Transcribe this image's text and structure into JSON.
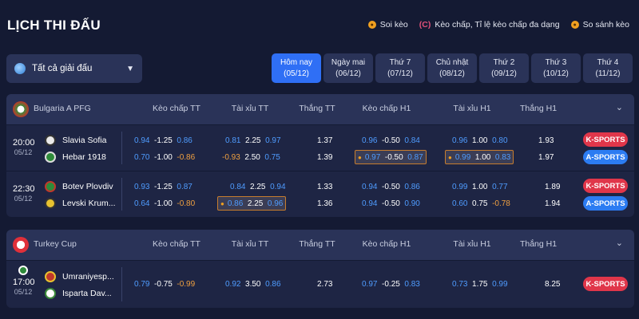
{
  "page": {
    "title": "LỊCH THI ĐẤU"
  },
  "legend": [
    {
      "icon": "coin-icon",
      "label": "Soi kèo"
    },
    {
      "icon": "c-icon",
      "label": "Kèo chấp, Tỉ lệ kèo chấp đa dạng"
    },
    {
      "icon": "coin-icon",
      "label": "So sánh kèo"
    }
  ],
  "league_select": {
    "label": "Tất cả giải đấu"
  },
  "days": [
    {
      "name": "Hôm nay",
      "date": "(05/12)",
      "active": true
    },
    {
      "name": "Ngày mai",
      "date": "(06/12)"
    },
    {
      "name": "Thứ 7",
      "date": "(07/12)"
    },
    {
      "name": "Chủ nhật",
      "date": "(08/12)"
    },
    {
      "name": "Thứ 2",
      "date": "(09/12)"
    },
    {
      "name": "Thứ 3",
      "date": "(10/12)"
    },
    {
      "name": "Thứ 4",
      "date": "(11/12)"
    }
  ],
  "columns": [
    "Kèo chấp TT",
    "Tài xỉu TT",
    "Thắng TT",
    "Kèo chấp H1",
    "Tài xỉu H1",
    "Thắng H1"
  ],
  "leagues": [
    {
      "name": "Bulgaria A PFG",
      "matches": [
        {
          "time": "20:00",
          "date": "05/12",
          "home": "Slavia Sofia",
          "away": "Hebar 1918",
          "home_row": {
            "hc_tt": [
              "0.94",
              "-1.25",
              "0.86"
            ],
            "ou_tt": [
              "0.81",
              "2.25",
              "0.97"
            ],
            "win_tt": "1.37",
            "hc_h1": [
              "0.96",
              "-0.50",
              "0.84"
            ],
            "ou_h1": [
              "0.96",
              "1.00",
              "0.80"
            ],
            "win_h1": "1.93"
          },
          "away_row": {
            "hc_tt": [
              "0.70",
              "-1.00",
              "-0.86"
            ],
            "ou_tt": [
              "-0.93",
              "2.50",
              "0.75"
            ],
            "win_tt": "1.39",
            "hc_h1": [
              "0.97",
              "-0.50",
              "0.87"
            ],
            "ou_h1": [
              "0.99",
              "1.00",
              "0.83"
            ],
            "win_h1": "1.97"
          },
          "buttons": [
            "K-SPORTS",
            "A-SPORTS"
          ]
        },
        {
          "time": "22:30",
          "date": "05/12",
          "home": "Botev Plovdiv",
          "away": "Levski Krum...",
          "home_row": {
            "hc_tt": [
              "0.93",
              "-1.25",
              "0.87"
            ],
            "ou_tt": [
              "0.84",
              "2.25",
              "0.94"
            ],
            "win_tt": "1.33",
            "hc_h1": [
              "0.94",
              "-0.50",
              "0.86"
            ],
            "ou_h1": [
              "0.99",
              "1.00",
              "0.77"
            ],
            "win_h1": "1.89"
          },
          "away_row": {
            "hc_tt": [
              "0.64",
              "-1.00",
              "-0.80"
            ],
            "ou_tt": [
              "0.86",
              "2.25",
              "0.96"
            ],
            "win_tt": "1.36",
            "hc_h1": [
              "0.94",
              "-0.50",
              "0.90"
            ],
            "ou_h1": [
              "0.60",
              "0.75",
              "-0.78"
            ],
            "win_h1": "1.94"
          },
          "buttons": [
            "K-SPORTS",
            "A-SPORTS"
          ]
        }
      ]
    },
    {
      "name": "Turkey Cup",
      "matches": [
        {
          "time": "17:00",
          "date": "05/12",
          "home": "Umraniyesp...",
          "away": "Isparta Dav...",
          "home_row": {
            "hc_tt": [
              "0.79",
              "-0.75",
              "-0.99"
            ],
            "ou_tt": [
              "0.92",
              "3.50",
              "0.86"
            ],
            "win_tt": "2.73",
            "hc_h1": [
              "0.97",
              "-0.25",
              "0.83"
            ],
            "ou_h1": [
              "0.73",
              "1.75",
              "0.99"
            ],
            "win_h1": "8.25"
          },
          "buttons": [
            "K-SPORTS"
          ]
        }
      ]
    }
  ],
  "colors": {
    "background": "#141a33",
    "panel": "#2a3358",
    "row": "#1e2544",
    "accent_blue": "#2f6ff5",
    "odds_blue": "#4f9cff",
    "odds_orange": "#f0a040",
    "k_sports": "#e0364a",
    "a_sports": "#2c7cf2"
  }
}
